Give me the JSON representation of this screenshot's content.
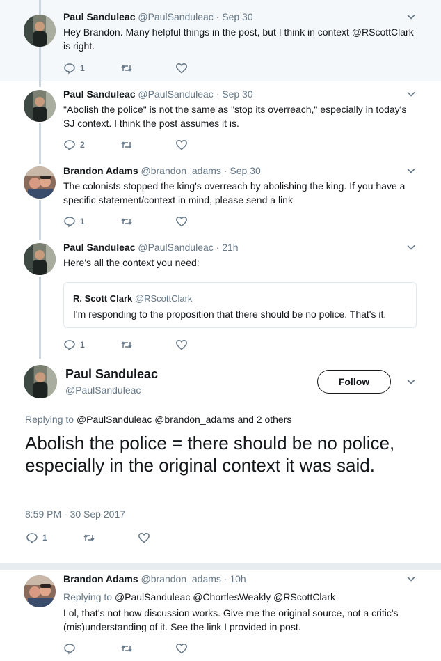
{
  "colors": {
    "accent": "#1da1f2",
    "text": "#14171a",
    "secondary": "#657786",
    "highlight_bg": "#f5f8fa"
  },
  "tweets": [
    {
      "name": "Paul Sanduleac",
      "handle": "@PaulSanduleac",
      "time": "Sep 30",
      "text": "Hey Brandon. Many helpful things in the post, but I think in context @RScottClark is right.",
      "replies": "1",
      "avatar": "paul"
    },
    {
      "name": "Paul Sanduleac",
      "handle": "@PaulSanduleac",
      "time": "Sep 30",
      "text": "\"Abolish the police\" is not the same as \"stop its overreach,\" especially in today's SJ context. I think the post assumes it is.",
      "replies": "2",
      "avatar": "paul"
    },
    {
      "name": "Brandon Adams",
      "handle": "@brandon_adams",
      "time": "Sep 30",
      "text": "The colonists stopped the king's overreach by abolishing the king. If you have a specific statement/context in mind, please send a link",
      "replies": "1",
      "avatar": "brandon"
    },
    {
      "name": "Paul Sanduleac",
      "handle": "@PaulSanduleac",
      "time": "21h",
      "text": "Here's all the context you need:",
      "replies": "1",
      "avatar": "paul",
      "quote": {
        "name": "R. Scott Clark",
        "handle": "@RScottClark",
        "text": "I'm responding to the proposition that there should be no police. That's it."
      }
    }
  ],
  "main_tweet": {
    "name": "Paul Sanduleac",
    "handle": "@PaulSanduleac",
    "follow_label": "Follow",
    "replying_prefix": "Replying to",
    "replying_to": "@PaulSanduleac @brandon_adams",
    "replying_suffix": "and 2 others",
    "text": "Abolish the police = there should be no police, especially in the original context it was said.",
    "timestamp": "8:59 PM - 30 Sep 2017",
    "replies": "1"
  },
  "reply_tweet": {
    "name": "Brandon Adams",
    "handle": "@brandon_adams",
    "time": "10h",
    "replying_prefix": "Replying to",
    "replying_to": "@PaulSanduleac @ChortlesWeakly @RScottClark",
    "text": "Lol, that's not how discussion works. Give me the original source, not a critic's (mis)understanding of it. See the link I provided in post.",
    "replies": ""
  },
  "separator": "·",
  "icons": [
    "reply-icon",
    "retweet-icon",
    "like-icon",
    "caret-down-icon"
  ]
}
